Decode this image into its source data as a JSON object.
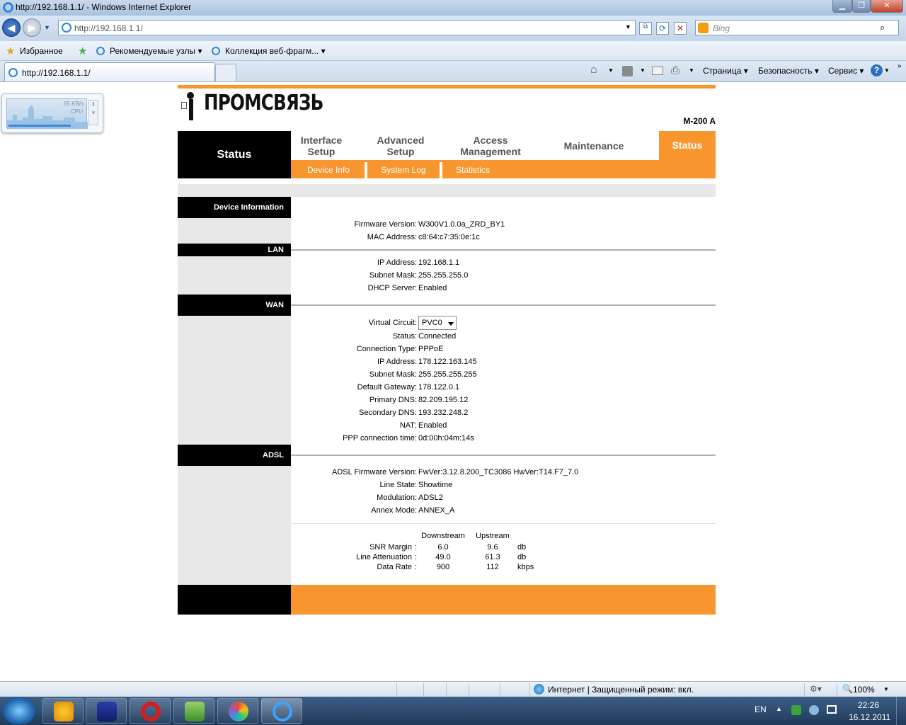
{
  "window": {
    "title": "http://192.168.1.1/ - Windows Internet Explorer",
    "address": "http://192.168.1.1/",
    "search_placeholder": "Bing",
    "tab_title": "http://192.168.1.1/"
  },
  "favorites_bar": {
    "favorites": "Избранное",
    "suggested": "Рекомендуемые узлы ▾",
    "gallery": "Коллекция веб-фрагм... ▾"
  },
  "command_bar": {
    "page": "Страница ▾",
    "safety": "Безопасность ▾",
    "tools": "Сервис ▾"
  },
  "gadget": {
    "speed": "65 KB/s",
    "label": "CPU"
  },
  "router": {
    "logo": "ПРОМСВЯЗЬ",
    "model": "M-200 A",
    "nav_active_title": "Status",
    "nav": [
      {
        "line1": "Interface",
        "line2": "Setup"
      },
      {
        "line1": "Advanced",
        "line2": "Setup"
      },
      {
        "line1": "Access",
        "line2": "Management"
      },
      {
        "line1": "Maintenance",
        "line2": ""
      }
    ],
    "nav_current": "Status",
    "subnav": [
      "Device Info",
      "System Log",
      "Statistics"
    ]
  },
  "sections": {
    "device": "Device Information",
    "lan": "LAN",
    "wan": "WAN",
    "adsl": "ADSL"
  },
  "device": {
    "firmware_label": "Firmware Version",
    "firmware": "W300V1.0.0a_ZRD_BY1",
    "mac_label": "MAC Address",
    "mac": "c8:64:c7:35:0e:1c"
  },
  "lan": {
    "ip_label": "IP Address",
    "ip": "192.168.1.1",
    "mask_label": "Subnet Mask",
    "mask": "255.255.255.0",
    "dhcp_label": "DHCP Server",
    "dhcp": "Enabled"
  },
  "wan": {
    "vc_label": "Virtual Circuit",
    "vc": "PVC0",
    "status_label": "Status",
    "status": "Connected",
    "type_label": "Connection Type",
    "type": "PPPoE",
    "ip_label": "IP Address",
    "ip": "178.122.163.145",
    "mask_label": "Subnet Mask",
    "mask": "255.255.255.255",
    "gw_label": "Default Gateway",
    "gw": "178.122.0.1",
    "pdns_label": "Primary DNS",
    "pdns": "82.209.195.12",
    "sdns_label": "Secondary DNS",
    "sdns": "193.232.248.2",
    "nat_label": "NAT",
    "nat": "Enabled",
    "ppp_label": "PPP connection time",
    "ppp": "0d:00h:04m:14s"
  },
  "adsl": {
    "fw_label": "ADSL Firmware Version",
    "fw": "FwVer:3.12.8.200_TC3086 HwVer:T14.F7_7.0",
    "state_label": "Line State",
    "state": "Showtime",
    "mod_label": "Modulation",
    "mod": "ADSL2",
    "annex_label": "Annex Mode",
    "annex": "ANNEX_A",
    "stats": {
      "headers": [
        "Downstream",
        "Upstream"
      ],
      "rows": [
        {
          "label": "SNR Margin",
          "down": "6.0",
          "up": "9.6",
          "unit": "db"
        },
        {
          "label": "Line Attenuation",
          "down": "49.0",
          "up": "61.3",
          "unit": "db"
        },
        {
          "label": "Data Rate",
          "down": "900",
          "up": "112",
          "unit": "kbps"
        }
      ]
    }
  },
  "statusbar": {
    "zone": "Интернет | Защищенный режим: вкл.",
    "zoom": "100%"
  },
  "taskbar": {
    "lang": "EN",
    "time": "22:26",
    "date": "16.12.2011"
  }
}
